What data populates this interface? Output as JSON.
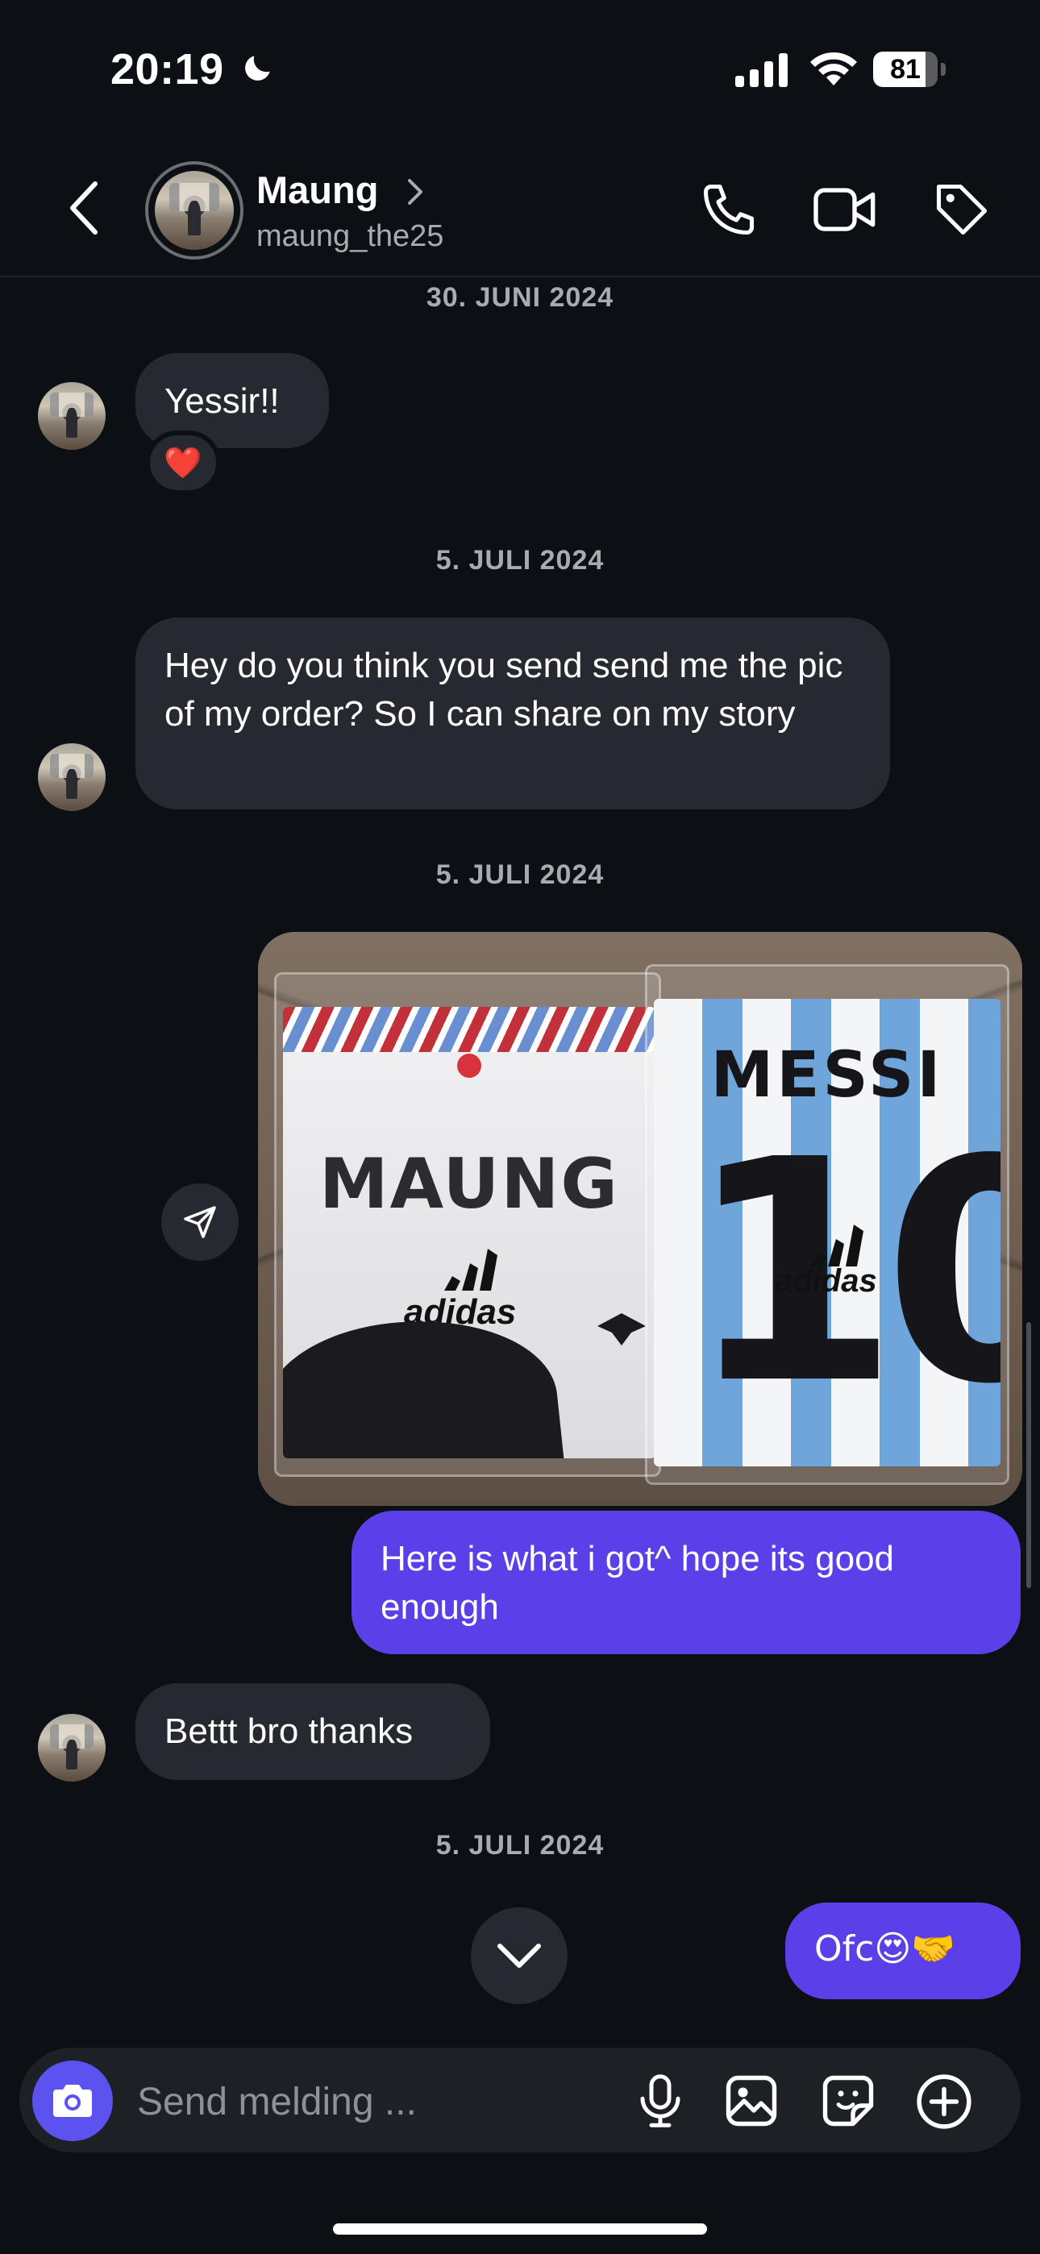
{
  "status_bar": {
    "time": "20:19",
    "battery": "81",
    "battery_level": 0.81
  },
  "header": {
    "name": "Maung",
    "username": "maung_the25"
  },
  "messages": {
    "date1": "30. JUNI 2024",
    "msg1": "Yessir!!",
    "msg1_reaction": "❤️",
    "date2": "5. JULI 2024",
    "msg2": "Hey do you think you send send me the pic of my order? So I can share on my story",
    "date3": "5. JULI 2024",
    "photo": {
      "shirt1_name": "MAUNG",
      "shirt1_brand": "adidas",
      "shirt2_name": "MESSI",
      "shirt2_number": "10",
      "shirt2_brand": "adidas"
    },
    "msg3": "Here is what i got^ hope its good enough",
    "msg4": "Bettt bro thanks",
    "date4": "5. JULI 2024",
    "msg5": "Ofc😍🤝"
  },
  "composer": {
    "placeholder": "Send melding ..."
  },
  "colors": {
    "background": "#0c1014",
    "incoming_bubble": "#262a30",
    "outgoing_bubble": "#5b3fe8",
    "camera_button": "#5b52f0",
    "meta_text": "#a8abb2"
  },
  "icons": [
    "moon-icon",
    "signal-icon",
    "wifi-icon",
    "battery-icon",
    "back-icon",
    "chevron-right-icon",
    "phone-icon",
    "video-icon",
    "tag-icon",
    "share-icon",
    "chevron-down-icon",
    "camera-icon",
    "mic-icon",
    "gallery-icon",
    "sticker-icon",
    "plus-circle-icon"
  ]
}
